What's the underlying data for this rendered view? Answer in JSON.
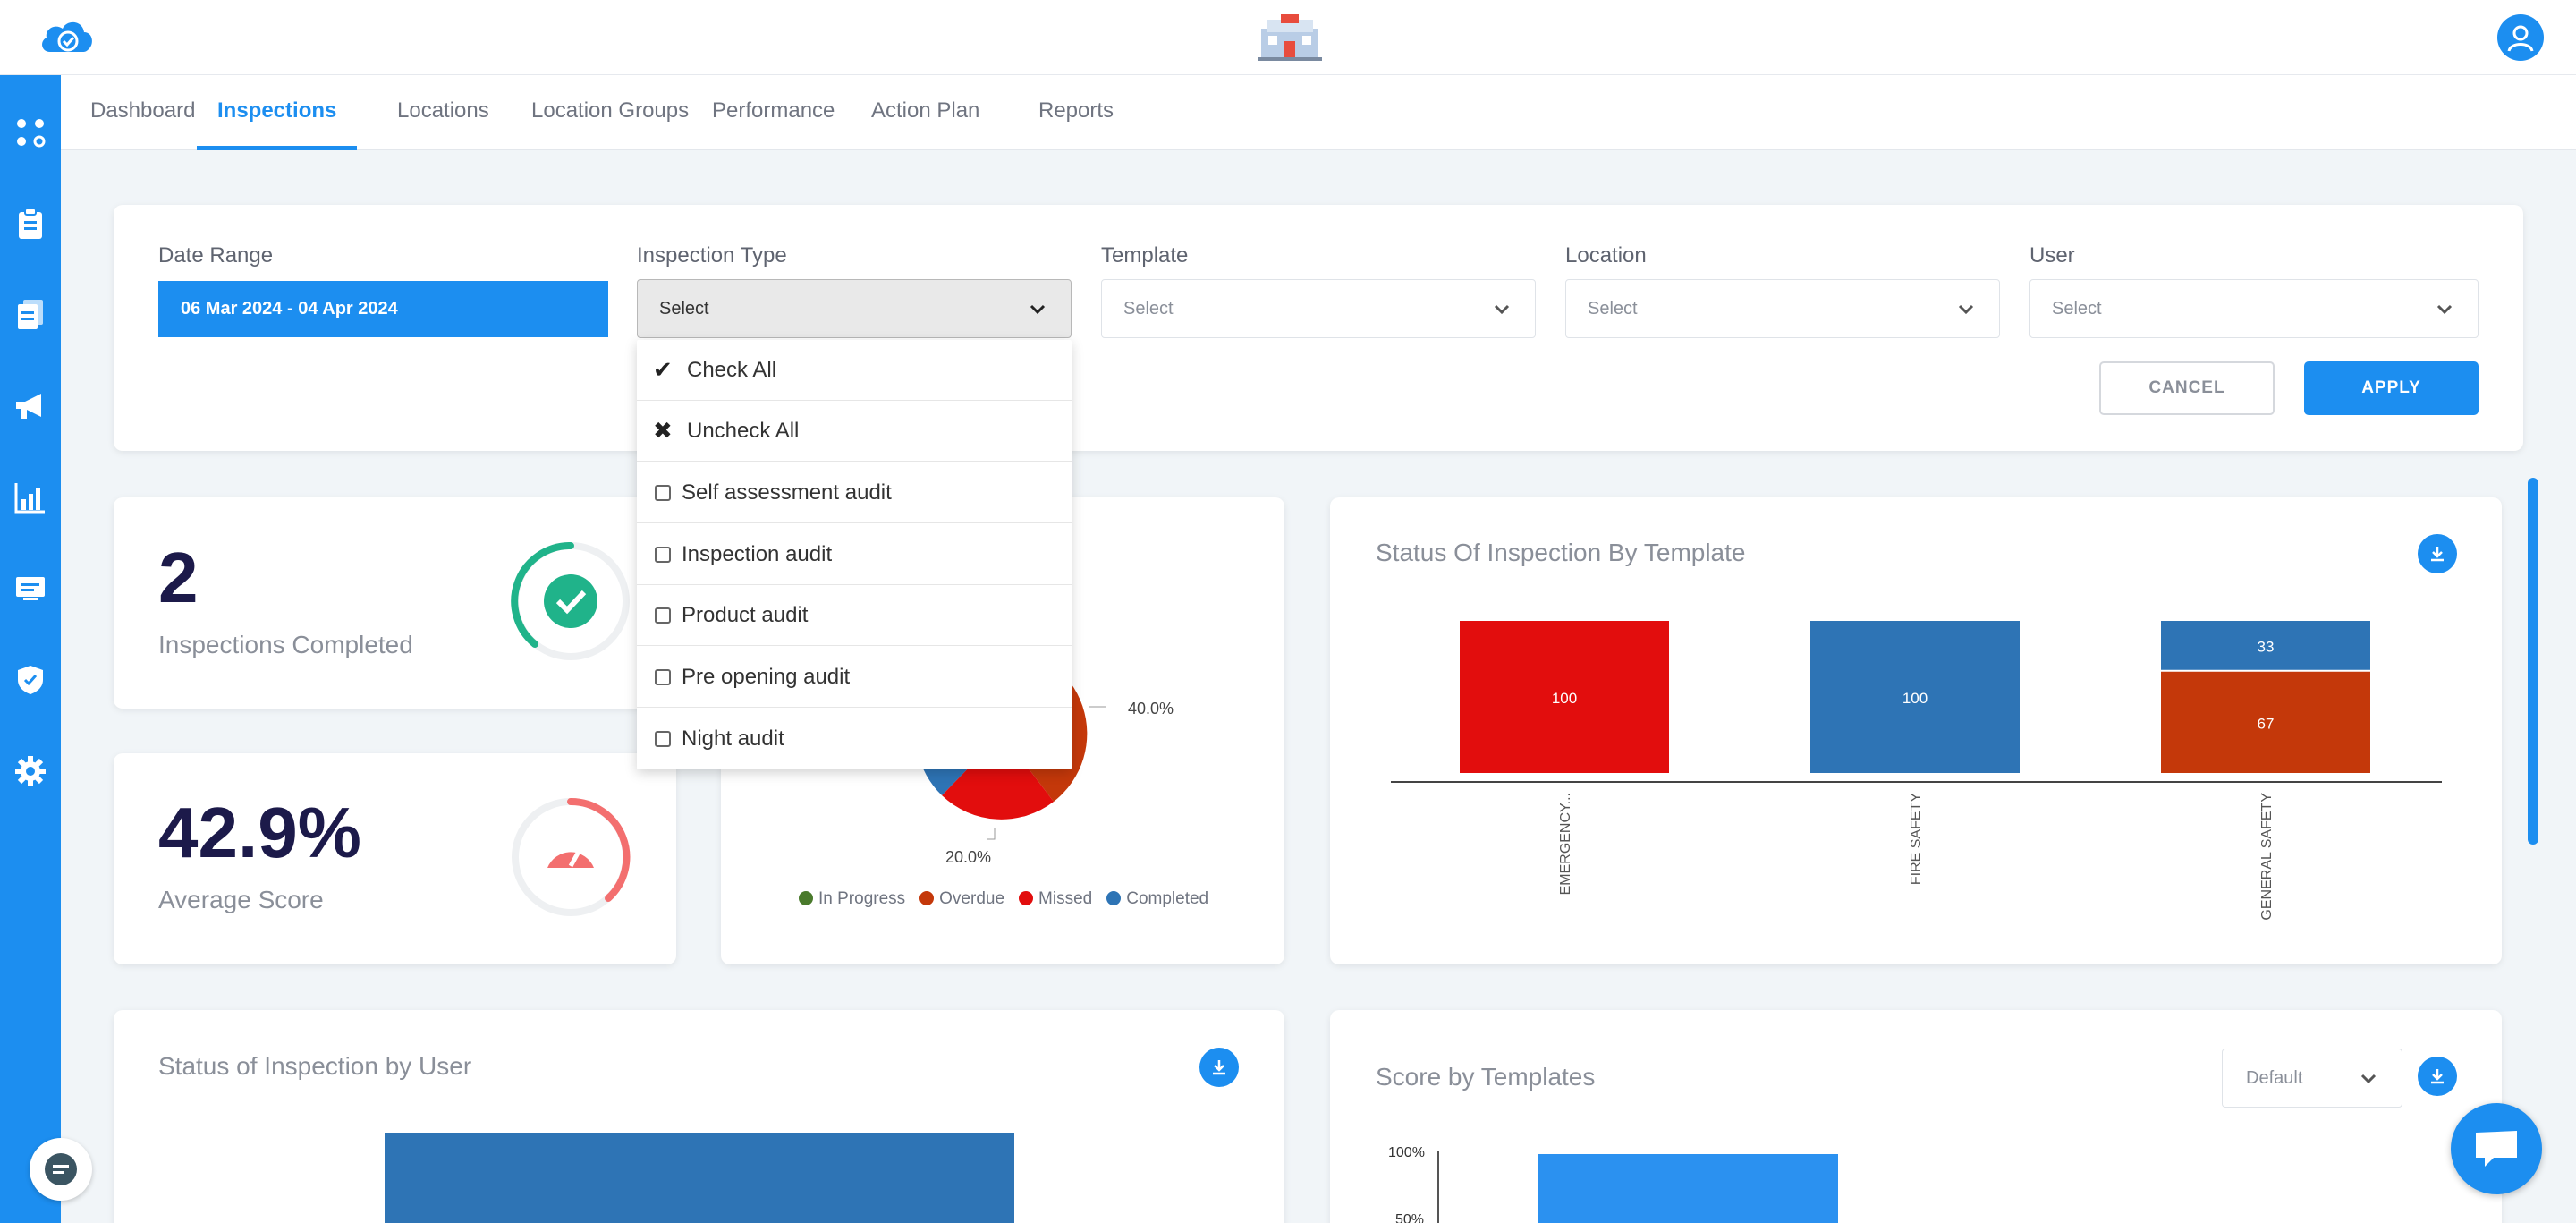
{
  "nav": {
    "tabs": [
      {
        "label": "Dashboard"
      },
      {
        "label": "Inspections",
        "active": true
      },
      {
        "label": "Locations"
      },
      {
        "label": "Location Groups"
      },
      {
        "label": "Performance"
      },
      {
        "label": "Action Plan"
      },
      {
        "label": "Reports"
      }
    ]
  },
  "filters": {
    "date_range": {
      "label": "Date Range",
      "value": "06 Mar 2024 - 04 Apr 2024"
    },
    "inspection_type": {
      "label": "Inspection Type",
      "value": "Select"
    },
    "template": {
      "label": "Template",
      "value": "Select"
    },
    "location": {
      "label": "Location",
      "value": "Select"
    },
    "user": {
      "label": "User",
      "value": "Select"
    },
    "cancel_label": "CANCEL",
    "apply_label": "APPLY"
  },
  "inspection_type_menu": {
    "check_all": "Check All",
    "uncheck_all": "Uncheck All",
    "options": [
      "Self assessment audit",
      "Inspection audit",
      "Product audit",
      "Pre opening audit",
      "Night audit"
    ]
  },
  "stats": {
    "completed": {
      "value": "2",
      "label": "Inspections Completed"
    },
    "average_score": {
      "value": "42.9%",
      "label": "Average Score"
    }
  },
  "pie_card": {
    "labels": {
      "pct_40": "40.0%",
      "pct_20": "20.0%"
    },
    "legend": [
      "In Progress",
      "Overdue",
      "Missed",
      "Completed"
    ]
  },
  "template_card": {
    "title": "Status Of Inspection By Template"
  },
  "user_card": {
    "title": "Status of Inspection by User"
  },
  "score_card": {
    "title": "Score by Templates",
    "sort": "Default",
    "y_ticks": [
      "100%",
      "50%"
    ]
  },
  "colors": {
    "primary": "#1c8ef0",
    "in_progress": "#4a7a2c",
    "overdue": "#c4380a",
    "missed": "#e20d0d",
    "completed": "#2e74b5"
  },
  "chart_data": [
    {
      "type": "pie",
      "labels": [
        "In Progress",
        "Overdue",
        "Missed",
        "Completed"
      ],
      "values": [
        0,
        40.0,
        20.0,
        40.0
      ],
      "legend": "bottom"
    },
    {
      "type": "bar",
      "title": "Status Of Inspection By Template",
      "categories": [
        "EMERGENCY...",
        "FIRE SAFETY",
        "GENERAL SAFETY"
      ],
      "series": [
        {
          "name": "Missed",
          "values": [
            100,
            0,
            0
          ]
        },
        {
          "name": "Completed",
          "values": [
            0,
            100,
            33
          ]
        },
        {
          "name": "Overdue",
          "values": [
            0,
            0,
            67
          ]
        }
      ],
      "ylim": [
        0,
        100
      ]
    }
  ]
}
